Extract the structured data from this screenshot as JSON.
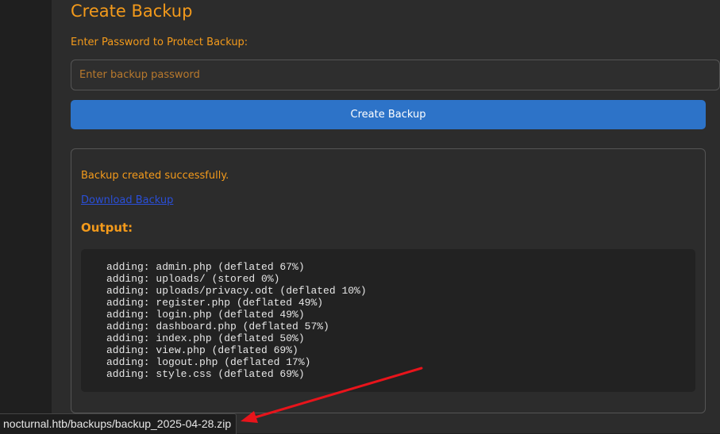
{
  "backup": {
    "title": "Create Backup",
    "password_label": "Enter Password to Protect Backup:",
    "password_placeholder": "Enter backup password",
    "password_value": "",
    "create_button_label": "Create Backup"
  },
  "result": {
    "success_message": "Backup created successfully.",
    "download_link_label": "Download Backup",
    "output_heading": "Output:",
    "output_lines": [
      "adding: admin.php (deflated 67%)",
      "adding: uploads/ (stored 0%)",
      "adding: uploads/privacy.odt (deflated 10%)",
      "adding: register.php (deflated 49%)",
      "adding: login.php (deflated 49%)",
      "adding: dashboard.php (deflated 57%)",
      "adding: index.php (deflated 50%)",
      "adding: view.php (deflated 69%)",
      "adding: logout.php (deflated 17%)",
      "adding: style.css (deflated 69%)"
    ]
  },
  "status_bar": {
    "url": "nocturnal.htb/backups/backup_2025-04-28.zip"
  },
  "colors": {
    "accent": "#f39a1b",
    "button": "#2d73c8",
    "link": "#2a4fd8",
    "annotation": "#e8141b"
  }
}
